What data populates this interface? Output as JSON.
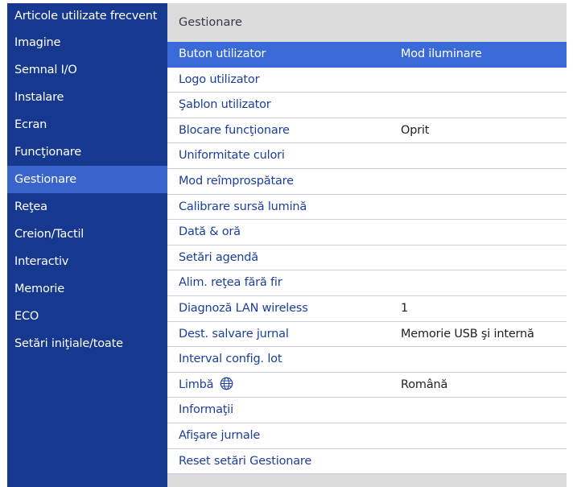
{
  "sidebar": {
    "items": [
      {
        "label": "Articole utilizate frecvent"
      },
      {
        "label": "Imagine"
      },
      {
        "label": "Semnal I/O"
      },
      {
        "label": "Instalare"
      },
      {
        "label": "Ecran"
      },
      {
        "label": "Funcţionare"
      },
      {
        "label": "Gestionare",
        "active": true
      },
      {
        "label": "Reţea"
      },
      {
        "label": "Creion/Tactil"
      },
      {
        "label": "Interactiv"
      },
      {
        "label": "Memorie"
      },
      {
        "label": "ECO"
      },
      {
        "label": "Setări iniţiale/toate"
      }
    ]
  },
  "main": {
    "title": "Gestionare",
    "rows": [
      {
        "label": "Buton utilizator",
        "value": "Mod iluminare",
        "selected": true
      },
      {
        "label": "Logo utilizator",
        "value": ""
      },
      {
        "label": "Şablon utilizator",
        "value": ""
      },
      {
        "label": "Blocare funcţionare",
        "value": "Oprit"
      },
      {
        "label": "Uniformitate culori",
        "value": ""
      },
      {
        "label": "Mod reîmprospătare",
        "value": ""
      },
      {
        "label": "Calibrare sursă lumină",
        "value": ""
      },
      {
        "label": "Dată & oră",
        "value": ""
      },
      {
        "label": "Setări agendă",
        "value": ""
      },
      {
        "label": "Alim. reţea fără fir",
        "value": ""
      },
      {
        "label": "Diagnoză LAN wireless",
        "value": "1"
      },
      {
        "label": "Dest. salvare jurnal",
        "value": "Memorie USB şi internă"
      },
      {
        "label": "Interval config. lot",
        "value": ""
      },
      {
        "label": "Limbă",
        "value": "Română",
        "icon": "globe-icon"
      },
      {
        "label": "Informaţii",
        "value": ""
      },
      {
        "label": "Afişare jurnale",
        "value": ""
      },
      {
        "label": "Reset setări Gestionare",
        "value": ""
      }
    ]
  },
  "colors": {
    "sidebar_bg": "#16388f",
    "sidebar_active": "#3964cc",
    "row_selected": "#3a6ad7",
    "row_label": "#1d3e9c",
    "panel_bg": "#dcdcdc"
  }
}
